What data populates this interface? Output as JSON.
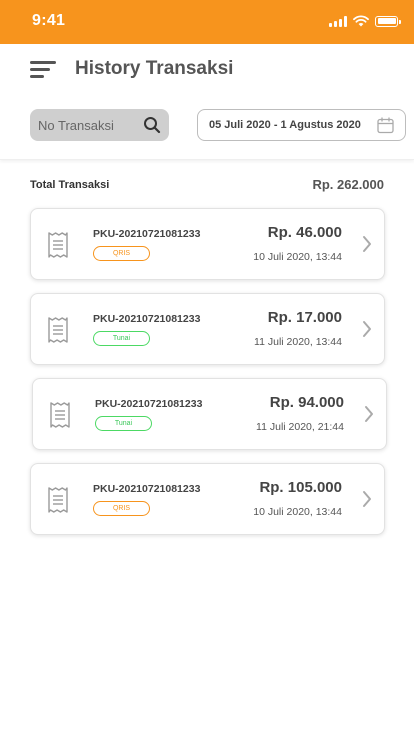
{
  "status_bar": {
    "time": "9:41"
  },
  "header": {
    "title": "History Transaksi",
    "search_placeholder": "No Transaksi",
    "date_range": "05 Juli 2020 - 1 Agustus 2020"
  },
  "summary": {
    "label": "Total Transaksi",
    "value": "Rp. 262.000"
  },
  "transactions": [
    {
      "id": "PKU-20210721081233",
      "method": "QRIS",
      "amount": "Rp. 46.000",
      "date": "10 Juli 2020, 13:44"
    },
    {
      "id": "PKU-20210721081233",
      "method": "Tunai",
      "amount": "Rp. 17.000",
      "date": "11 Juli 2020, 13:44"
    },
    {
      "id": "PKU-20210721081233",
      "method": "Tunai",
      "amount": "Rp. 94.000",
      "date": "11 Juli 2020, 21:44"
    },
    {
      "id": "PKU-20210721081233",
      "method": "QRIS",
      "amount": "Rp. 105.000",
      "date": "10 Juli 2020, 13:44"
    }
  ],
  "colors": {
    "brand": "#F7941D",
    "qris_badge": "#F7941D",
    "tunai_badge": "#4CD964"
  }
}
